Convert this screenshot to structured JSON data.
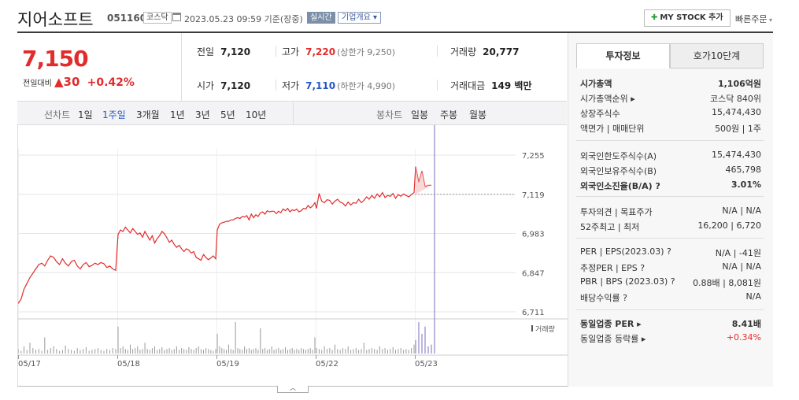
{
  "header": {
    "name": "지어소프트",
    "code": "051160",
    "market": "코스닥",
    "datetime": "2023.05.23 09:59  기준(장중)",
    "realtime": "실시간",
    "corp_info": "기업개요 ▾",
    "mystock": "MY STOCK 추가",
    "quick_order": "빠른주문"
  },
  "price": {
    "current": "7,150",
    "change_label": "전일대비",
    "change_amount": "▲30",
    "change_percent": "+0.42%"
  },
  "quote": {
    "prev_label": "전일",
    "prev": "7,120",
    "high_label": "고가",
    "high": "7,220",
    "upper_limit": "(상한가 9,250)",
    "volume_label": "거래량",
    "volume": "20,777",
    "open_label": "시가",
    "open": "7,120",
    "low_label": "저가",
    "low": "7,110",
    "lower_limit": "(하한가 4,990)",
    "amount_label": "거래대금",
    "amount": "149 백만"
  },
  "toolbar": {
    "line_label": "선차트",
    "periods": [
      "1일",
      "1주일",
      "3개월",
      "1년",
      "3년",
      "5년",
      "10년"
    ],
    "selected": "1주일",
    "candle_label": "봉차트",
    "candles": [
      "일봉",
      "주봉",
      "월봉"
    ]
  },
  "chart_data": {
    "type": "line",
    "x_ticks": [
      "05/17",
      "05/18",
      "05/19",
      "05/22",
      "05/23"
    ],
    "y_ticks": [
      7255,
      7119,
      6983,
      6847,
      6711
    ],
    "ylim": [
      6711,
      7255
    ],
    "volume_label": "거래량",
    "reference_price": 7119,
    "colors": {
      "line": "#e32b2b",
      "reference": "#999999",
      "volume": "#999999"
    },
    "series": [
      {
        "values": [
          6740,
          6755,
          6790,
          6810,
          6830,
          6845,
          6860,
          6875,
          6880,
          6870,
          6890,
          6905,
          6900,
          6885,
          6875,
          6895,
          6880,
          6870,
          6885,
          6890,
          6870,
          6860,
          6875,
          6882,
          6868,
          6872,
          6880,
          6875,
          6882,
          6878,
          6865,
          6870,
          6860,
          6855,
          6980,
          6995,
          6990,
          7005,
          6995,
          6985,
          7000,
          6990,
          6980,
          6985,
          6970,
          6990,
          6975,
          6960,
          6975,
          6950,
          6965,
          6975,
          6990,
          6982,
          6968,
          6952,
          6960,
          6945,
          6935,
          6942,
          6930,
          6920,
          6930,
          6925,
          6915,
          6920,
          6900,
          6895,
          6890,
          6910,
          6900,
          6892,
          6898,
          6905,
          6895,
          6995,
          7015,
          7020,
          7022,
          7025,
          7025,
          7030,
          7030,
          7035,
          7038,
          7035,
          7042,
          7040,
          7045,
          7030,
          7050,
          7038,
          7048,
          7042,
          7055,
          7058,
          7050,
          7062,
          7058,
          7060,
          7060,
          7052,
          7060,
          7055,
          7068,
          7062,
          7070,
          7058,
          7065,
          7062,
          7068,
          7058,
          7062,
          7070,
          7068,
          7080,
          7072,
          7078,
          7090,
          7070,
          7122,
          7095,
          7090,
          7100,
          7098,
          7085,
          7095,
          7102,
          7092,
          7088,
          7078,
          7092,
          7082,
          7090,
          7088,
          7102,
          7090,
          7098,
          7110,
          7102,
          7115,
          7105,
          7120,
          7110,
          7125,
          7108,
          7115,
          7112,
          7122,
          7105,
          7118,
          7112,
          7120,
          7115,
          7110,
          7118,
          7125,
          7215,
          7160,
          7200,
          7145,
          7150,
          7150
        ]
      }
    ],
    "volume": [
      5,
      3,
      8,
      4,
      12,
      6,
      4,
      5,
      3,
      18,
      4,
      6,
      8,
      5,
      3,
      4,
      9,
      5,
      4,
      3,
      6,
      4,
      5,
      7,
      3,
      4,
      5,
      6,
      4,
      3,
      5,
      4,
      6,
      5,
      30,
      6,
      8,
      5,
      4,
      10,
      5,
      6,
      8,
      4,
      5,
      12,
      5,
      4,
      6,
      8,
      4,
      5,
      7,
      4,
      5,
      6,
      4,
      5,
      8,
      4,
      6,
      5,
      4,
      7,
      5,
      4,
      6,
      8,
      5,
      4,
      6,
      5,
      4,
      3,
      5,
      22,
      8,
      6,
      5,
      4,
      10,
      5,
      4,
      35,
      6,
      5,
      4,
      8,
      5,
      6,
      4,
      5,
      6,
      4,
      28,
      5,
      6,
      4,
      5,
      8,
      4,
      5,
      6,
      4,
      5,
      7,
      4,
      5,
      6,
      4,
      5,
      4,
      6,
      5,
      4,
      5,
      6,
      4,
      18,
      6,
      5,
      4,
      8,
      5,
      6,
      4,
      10,
      5,
      4,
      6,
      5,
      8,
      4,
      5,
      6,
      4,
      5,
      12,
      4,
      5,
      6,
      5,
      4,
      8,
      5,
      6,
      4,
      5,
      7,
      4,
      5,
      6,
      4,
      5,
      4,
      6,
      10,
      15,
      35,
      22,
      30,
      8,
      10
    ]
  },
  "invest": {
    "tabs": [
      "투자정보",
      "호가10단계"
    ],
    "rows1": [
      {
        "k": "시가총액",
        "v": "1,106억원",
        "bold": true
      },
      {
        "k": "시가총액순위 ▸",
        "v": "코스닥 840위"
      },
      {
        "k": "상장주식수",
        "v": "15,474,430"
      },
      {
        "k": "액면가 | 매매단위",
        "v": "500원 | 1주"
      }
    ],
    "rows2": [
      {
        "k": "외국인한도주식수(A)",
        "v": "15,474,430"
      },
      {
        "k": "외국인보유주식수(B)",
        "v": "465,798"
      },
      {
        "k": "외국인소진율(B/A) ?",
        "v": "3.01%",
        "bold": true
      }
    ],
    "rows3": [
      {
        "k": "투자의견 | 목표주가",
        "v": "N/A | N/A"
      },
      {
        "k": "52주최고 | 최저",
        "v": "16,200 | 6,720"
      }
    ],
    "rows4": [
      {
        "k": "PER | EPS(2023.03) ?",
        "v": "N/A | -41원"
      },
      {
        "k": "추정PER | EPS ?",
        "v": "N/A | N/A"
      },
      {
        "k": "PBR | BPS (2023.03) ?",
        "v": "0.88배 | 8,081원"
      },
      {
        "k": "배당수익률 ?",
        "v": "N/A"
      }
    ],
    "rows5": [
      {
        "k": "동일업종 PER ▸",
        "v": "8.41배",
        "bold": true
      },
      {
        "k": "동일업종 등락률 ▸",
        "v": "+0.34%",
        "red": true
      }
    ]
  }
}
